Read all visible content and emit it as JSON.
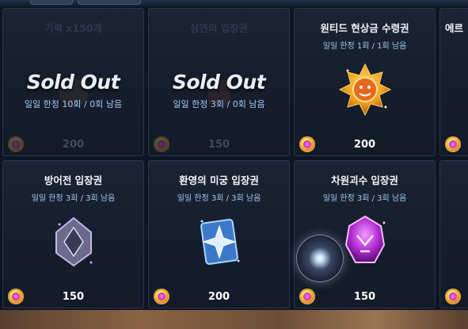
{
  "cards": [
    {
      "title": "기력 x150개",
      "sold_out_text": "Sold Out",
      "limit": "일일 한정 10회 / 0회 남음",
      "price": "200",
      "icon": "stamina-icon"
    },
    {
      "title": "심연의 입장권",
      "sold_out_text": "Sold Out",
      "limit": "일일 한정 3회 / 0회 남음",
      "price": "150",
      "icon": "abyss-ticket-icon"
    },
    {
      "title": "원티드 현상금 수령권",
      "limit": "일일 한정 1회 / 1회 남음",
      "price": "200",
      "icon": "bounty-medal-icon"
    },
    {
      "title": "에르",
      "price": ""
    },
    {
      "title": "방어전 입장권",
      "limit": "일일 한정 3회 / 3회 남음",
      "price": "150",
      "icon": "defense-ticket-icon"
    },
    {
      "title": "환영의 미궁 입장권",
      "limit": "일일 한정 3회 / 3회 남음",
      "price": "200",
      "icon": "labyrinth-ticket-icon"
    },
    {
      "title": "차원괴수 입장권",
      "limit": "일일 한정 3회 / 3회 남음",
      "price": "150",
      "icon": "dimension-beast-ticket-icon"
    }
  ],
  "currency_icon": "gem-coin-icon",
  "colors": {
    "card_bg": "#171e2e",
    "limit_text": "#9fc7f0",
    "border": "#2b3550"
  }
}
